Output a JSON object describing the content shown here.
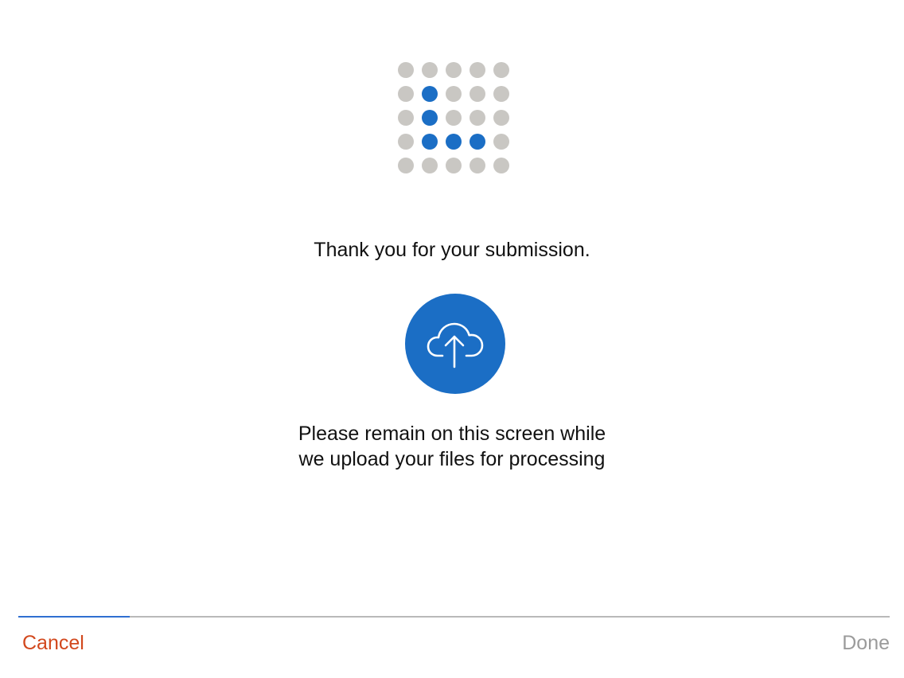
{
  "logo": {
    "icon": "dot-grid-logo-icon",
    "grid_rows": 5,
    "grid_cols": 5,
    "highlighted_cells": [
      [
        1,
        1
      ],
      [
        2,
        1
      ],
      [
        3,
        1
      ],
      [
        3,
        2
      ],
      [
        3,
        3
      ]
    ],
    "dot_color": "#c9c7c3",
    "highlight_color": "#1b6ec5"
  },
  "main": {
    "thank_you_text": "Thank you for your submission.",
    "upload_icon": "cloud-upload-icon",
    "upload_circle_color": "#1b6ec5",
    "message_line_1": "Please remain on this screen while",
    "message_line_2": "we upload your files for processing"
  },
  "progress": {
    "fraction": 0.128,
    "fill_color": "#2f6fd1",
    "track_color": "#b9b9b9"
  },
  "footer": {
    "cancel_label": "Cancel",
    "cancel_color": "#d2481d",
    "done_label": "Done",
    "done_color": "#9b9b9b"
  }
}
